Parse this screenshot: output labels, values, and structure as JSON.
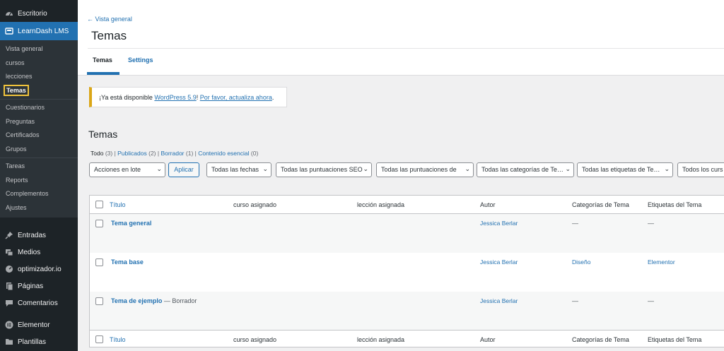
{
  "sidebar": {
    "top_items": [
      {
        "label": "Escritorio",
        "icon": "dashboard-icon"
      },
      {
        "label": "LearnDash LMS",
        "icon": "learndash-icon"
      }
    ],
    "submenu_group1": [
      "Vista general",
      "cursos",
      "lecciones",
      "Temas"
    ],
    "submenu_group2": [
      "Cuestionarios",
      "Preguntas",
      "Certificados",
      "Grupos"
    ],
    "submenu_group3": [
      "Tareas",
      "Reports",
      "Complementos",
      "Ajustes"
    ],
    "bottom_items": [
      {
        "label": "Entradas",
        "icon": "pin-icon"
      },
      {
        "label": "Medios",
        "icon": "media-icon"
      },
      {
        "label": "optimizador.io",
        "icon": "gauge-icon"
      },
      {
        "label": "Páginas",
        "icon": "page-icon"
      },
      {
        "label": "Comentarios",
        "icon": "comment-icon"
      },
      {
        "label": "Elementor",
        "icon": "elementor-icon"
      },
      {
        "label": "Plantillas",
        "icon": "folder-icon"
      }
    ]
  },
  "header": {
    "back_link": "← Vista general",
    "title": "Temas",
    "tabs": [
      "Temas",
      "Settings"
    ]
  },
  "notice": {
    "prefix": "¡Ya está disponible ",
    "link1": "WordPress 5.9",
    "middle": "! ",
    "link2": "Por favor, actualiza ahora",
    "suffix": "."
  },
  "content": {
    "title": "Temas",
    "views": {
      "todo": "Todo",
      "todo_count": "(3)",
      "publicados": "Publicados",
      "publicados_count": "(2)",
      "borrador": "Borrador",
      "borrador_count": "(1)",
      "esencial": "Contenido esencial",
      "esencial_count": "(0)"
    },
    "bulk_action": "Acciones en lote",
    "apply": "Aplicar",
    "filters": [
      "Todas las fechas",
      "Todas las puntuaciones SEO",
      "Todas las puntuaciones de",
      "Todas las categorías de Te…",
      "Todas las etiquetas de Te…",
      "Todos los curs"
    ]
  },
  "table": {
    "columns": [
      "Título",
      "curso asignado",
      "lección asignada",
      "Autor",
      "Categorías de Tema",
      "Etiquetas del Tema"
    ],
    "rows": [
      {
        "title": "Tema general",
        "state": "",
        "author": "Jessica Berlar",
        "category": "—",
        "tags": "—"
      },
      {
        "title": "Tema base",
        "state": "",
        "author": "Jessica Berlar",
        "category": "Diseño",
        "tags": "Elementor"
      },
      {
        "title": "Tema de ejemplo",
        "state": " — Borrador",
        "author": "Jessica Berlar",
        "category": "—",
        "tags": "—"
      }
    ]
  }
}
